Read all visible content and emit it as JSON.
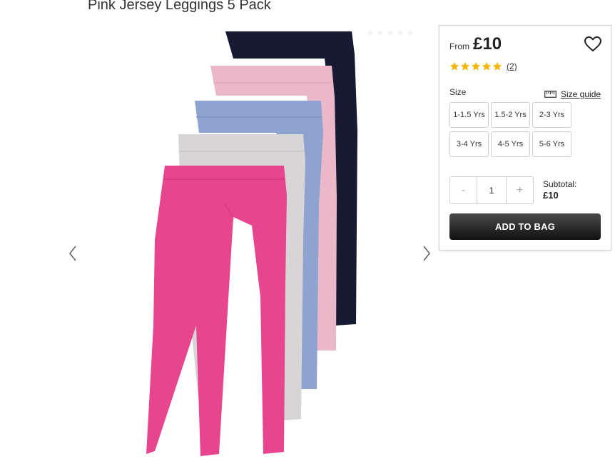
{
  "product": {
    "title": "Pink Jersey Leggings 5 Pack"
  },
  "gallery": {
    "image_name": "leggings-5-pack-image",
    "legging_colors": [
      "#161b33",
      "#ebb8c9",
      "#8ea3cf",
      "#d7d5d6",
      "#e7458d"
    ],
    "carousel_dot_count": 5
  },
  "pricing": {
    "from_label": "From",
    "price": "£10"
  },
  "rating": {
    "stars": 5,
    "max_stars": 5,
    "review_count": "(2)",
    "star_color": "#f5b400"
  },
  "sizes": {
    "label": "Size",
    "guide_label": "Size guide",
    "options": [
      "1-1.5 Yrs",
      "1.5-2 Yrs",
      "2-3 Yrs",
      "3-4 Yrs",
      "4-5 Yrs",
      "5-6 Yrs"
    ]
  },
  "quantity": {
    "minus": "-",
    "value": "1",
    "plus": "+"
  },
  "subtotal": {
    "label": "Subtotal:",
    "value": "£10"
  },
  "actions": {
    "add_to_bag": "ADD TO BAG"
  },
  "icons": {
    "favorite": "heart-icon",
    "size_guide": "ruler-icon",
    "prev": "chevron-left-icon",
    "next": "chevron-right-icon",
    "star": "star-icon"
  }
}
